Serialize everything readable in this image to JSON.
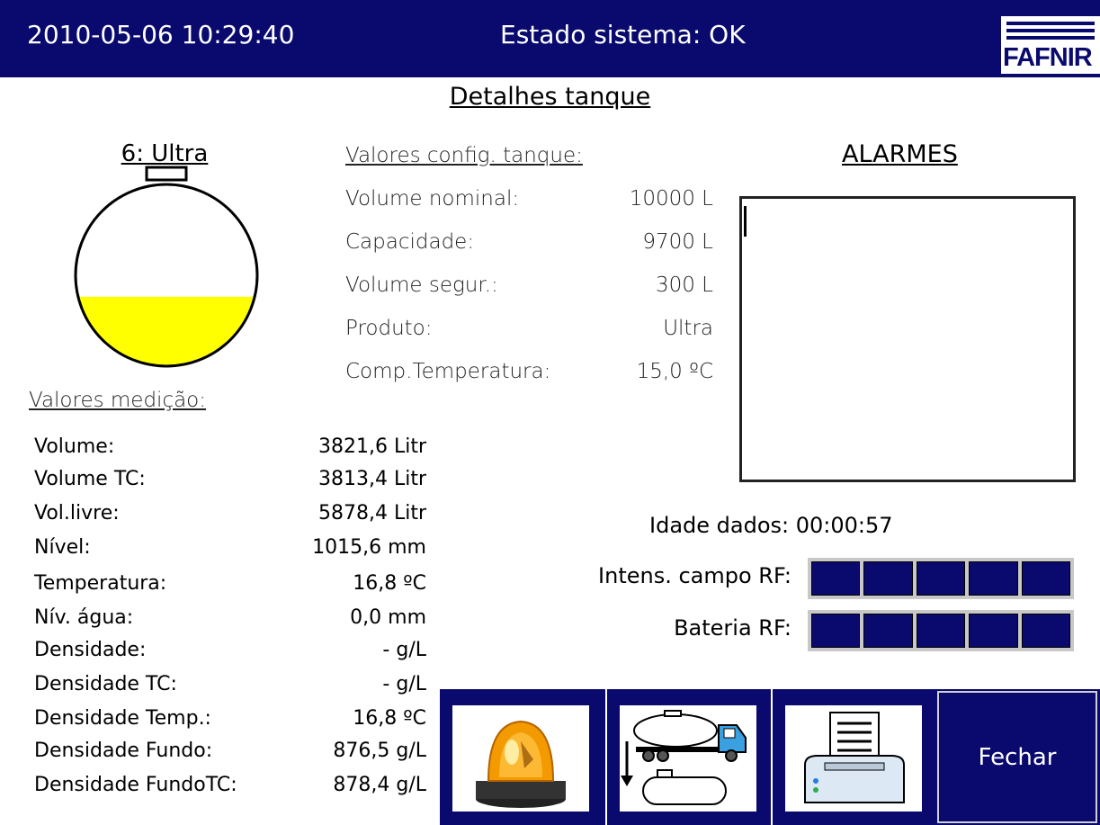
{
  "header": {
    "datetime": "2010-05-06  10:29:40",
    "status": "Estado sistema: OK",
    "logo_text": "FAFNIR"
  },
  "page_title": "Detalhes tanque",
  "tank": {
    "name": "6: Ultra",
    "fill_level": 0.382,
    "fill_color": "#ffff00"
  },
  "config": {
    "header": "Valores config. tanque:",
    "rows": [
      {
        "label": "Volume nominal:",
        "value": "10000 L"
      },
      {
        "label": "Capacidade:",
        "value": "9700 L"
      },
      {
        "label": "Volume segur.:",
        "value": "300 L"
      },
      {
        "label": "Produto:",
        "value": "Ultra"
      },
      {
        "label": "Comp.Temperatura:",
        "value": "15,0 ºC"
      }
    ]
  },
  "alarms": {
    "title": "ALARMES"
  },
  "measurement": {
    "header": "Valores medição:",
    "rows": [
      {
        "label": "Volume:",
        "value": "3821,6 Litr"
      },
      {
        "label": "Volume TC:",
        "value": "3813,4 Litr"
      },
      {
        "label": "Vol.livre:",
        "value": "5878,4 Litr"
      },
      {
        "label": "Nível:",
        "value": "1015,6 mm"
      },
      {
        "label": "Temperatura:",
        "value": "16,8 ºC"
      },
      {
        "label": "Nív. água:",
        "value": "0,0 mm"
      },
      {
        "label": "Densidade:",
        "value": "-  g/L"
      },
      {
        "label": "Densidade TC:",
        "value": "-  g/L"
      },
      {
        "label": "Densidade Temp.:",
        "value": "16,8 ºC"
      },
      {
        "label": "Densidade Fundo:",
        "value": "876,5 g/L"
      },
      {
        "label": "Densidade FundoTC:",
        "value": "878,4 g/L"
      }
    ]
  },
  "status": {
    "data_age_label": "Idade dados: 00:00:57",
    "rf_field_label": "Intens. campo RF:",
    "rf_field_level": 5,
    "battery_label": "Bateria RF:",
    "battery_level": 5
  },
  "buttons": {
    "alarm_icon": "alarm-beacon-icon",
    "delivery_icon": "tanker-delivery-icon",
    "print_icon": "printer-icon",
    "close_label": "Fechar"
  }
}
